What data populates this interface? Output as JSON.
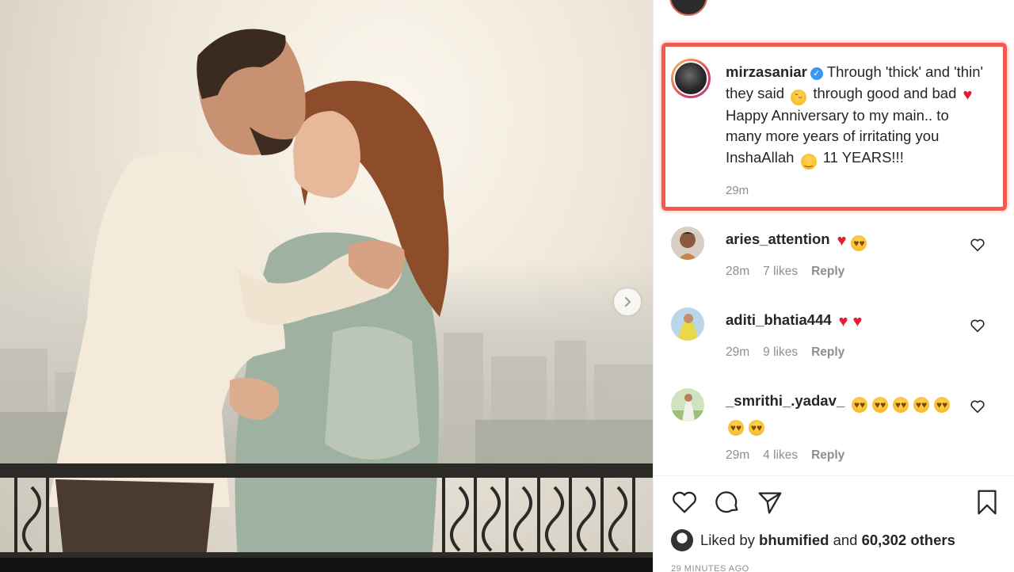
{
  "caption": {
    "username": "mirzasaniar",
    "text_1": "Through 'thick' and 'thin' they said",
    "text_2": "through good and bad",
    "text_3": "Happy Anniversary to my main.. to many more years of irritating you InshaAllah",
    "text_4": "11 YEARS!!!",
    "time": "29m"
  },
  "comments": [
    {
      "username": "aries_attention",
      "time": "28m",
      "likes": "7 likes",
      "reply": "Reply"
    },
    {
      "username": "aditi_bhatia444",
      "time": "29m",
      "likes": "9 likes",
      "reply": "Reply"
    },
    {
      "username": "_smrithi_.yadav_",
      "time": "29m",
      "likes": "4 likes",
      "reply": "Reply"
    }
  ],
  "likes": {
    "prefix": "Liked by",
    "user": "bhumified",
    "middle": "and",
    "others": "60,302 others"
  },
  "posted_ago": "29 MINUTES AGO",
  "colors": {
    "highlight": "#f05a4f",
    "verified": "#3897f0",
    "heart": "#e0202e",
    "meta_text": "#8e8e8e"
  },
  "icons": [
    "chevron-right-icon",
    "heart-outline-icon",
    "comment-icon",
    "share-icon",
    "bookmark-icon",
    "verified-icon"
  ]
}
